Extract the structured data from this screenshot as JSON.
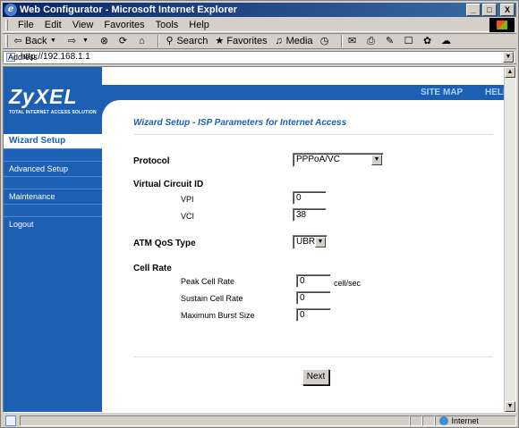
{
  "window": {
    "title": "Web Configurator - Microsoft Internet Explorer",
    "btn_min": "_",
    "btn_max": "□",
    "btn_close": "X"
  },
  "menu": {
    "items": [
      "File",
      "Edit",
      "View",
      "Favorites",
      "Tools",
      "Help"
    ]
  },
  "toolbar": {
    "back": "Back",
    "search": "Search",
    "favorites": "Favorites",
    "media": "Media"
  },
  "address": {
    "label": "Address",
    "url": "http://192.168.1.1"
  },
  "brand": {
    "logo": "ZyXEL",
    "tagline": "TOTAL INTERNET ACCESS SOLUTION"
  },
  "header_links": {
    "site_map": "SITE MAP",
    "help": "HELP"
  },
  "nav": {
    "wizard": "Wizard Setup",
    "advanced": "Advanced Setup",
    "maintenance": "Maintenance",
    "logout": "Logout"
  },
  "page": {
    "title": "Wizard Setup - ISP Parameters for Internet Access"
  },
  "form": {
    "protocol_label": "Protocol",
    "protocol_value": "PPPoA/VC",
    "vcid_label": "Virtual Circuit ID",
    "vpi_label": "VPI",
    "vpi_value": "0",
    "vci_label": "VCI",
    "vci_value": "38",
    "qos_label": "ATM QoS Type",
    "qos_value": "UBR",
    "cellrate_label": "Cell Rate",
    "peak_label": "Peak Cell Rate",
    "peak_value": "0",
    "peak_unit": "cell/sec",
    "sustain_label": "Sustain Cell Rate",
    "sustain_value": "0",
    "burst_label": "Maximum Burst Size",
    "burst_value": "0",
    "next_button": "Next"
  },
  "status": {
    "zone": "Internet"
  }
}
